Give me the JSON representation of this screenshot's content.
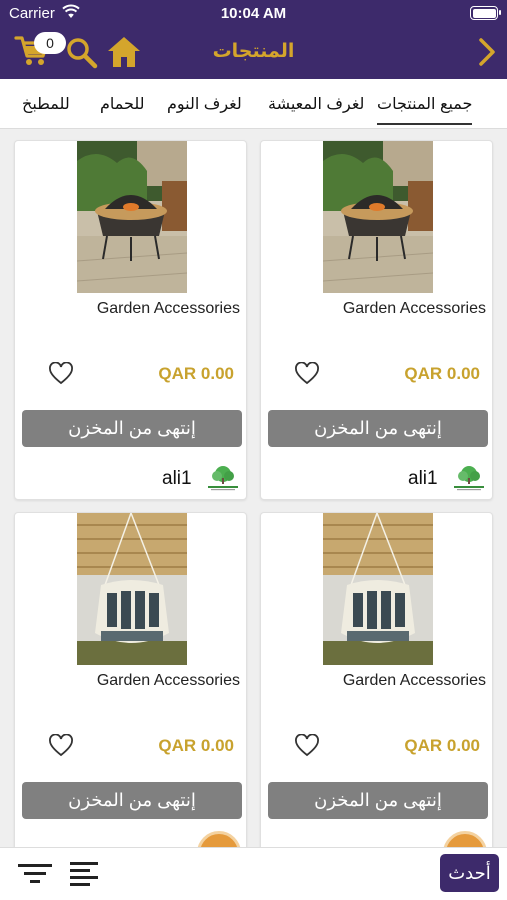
{
  "status": {
    "carrier": "Carrier",
    "time": "10:04 AM"
  },
  "nav": {
    "title": "المنتجات",
    "cart_count": "0"
  },
  "tabs": [
    {
      "label": "جميع المنتجات",
      "active": true
    },
    {
      "label": "لغرف المعيشة"
    },
    {
      "label": "لغرف النوم"
    },
    {
      "label": "للحمام"
    },
    {
      "label": "للمطبخ"
    }
  ],
  "products": [
    {
      "name": "Garden Accessories",
      "price": "QAR 0.00",
      "stock_label": "إنتهى من المخزن",
      "seller": "ali1",
      "image": "fire-pit-photo"
    },
    {
      "name": "Garden Accessories",
      "price": "QAR 0.00",
      "stock_label": "إنتهى من المخزن",
      "seller": "ali1",
      "image": "fire-pit-photo"
    },
    {
      "name": "Garden Accessories",
      "price": "QAR 0.00",
      "stock_label": "إنتهى من المخزن",
      "image": "hammock-chair-photo"
    },
    {
      "name": "Garden Accessories",
      "price": "QAR 0.00",
      "stock_label": "إنتهى من المخزن",
      "image": "hammock-chair-photo"
    }
  ],
  "bottom": {
    "newest_label": "أحدث"
  },
  "colors": {
    "brand": "#3d2a6b",
    "accent": "#d4a52c",
    "price": "#c8a22e",
    "out_of_stock": "#808080"
  }
}
